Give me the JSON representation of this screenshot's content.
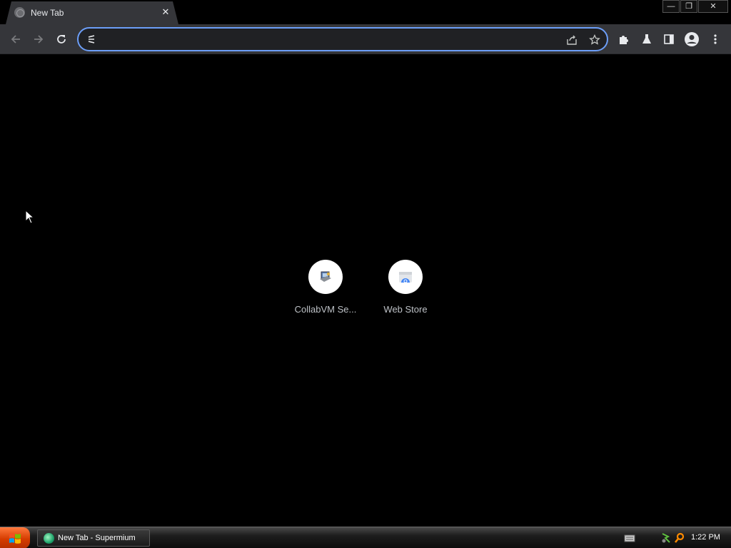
{
  "browser": {
    "tab": {
      "title": "New Tab",
      "close_glyph": "✕"
    },
    "window_controls": {
      "minimize": "—",
      "restore": "❐",
      "close": "✕"
    },
    "omnibox": {
      "value": "",
      "placeholder": ""
    },
    "toolbar_icons": [
      "back-arrow-icon",
      "forward-arrow-icon",
      "reload-icon",
      "share-icon",
      "bookmark-star-icon",
      "extensions-puzzle-icon",
      "labs-flask-icon",
      "side-panel-icon",
      "profile-avatar-icon",
      "menu-kebab-icon"
    ]
  },
  "new_tab": {
    "shortcuts": [
      {
        "label": "CollabVM Se...",
        "icon": "collabvm-icon"
      },
      {
        "label": "Web Store",
        "icon": "web-store-icon"
      }
    ]
  },
  "taskbar": {
    "task_label": "New Tab - Supermium",
    "clock": "1:22 PM"
  },
  "colors": {
    "background": "#000000",
    "toolbar": "#35363a",
    "omnibox_focus": "#6c9ef8",
    "start_button": "#d53c00"
  }
}
